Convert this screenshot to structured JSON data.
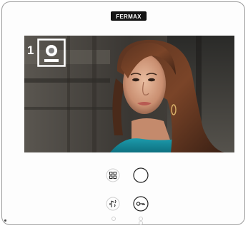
{
  "brand": {
    "logo_text": "FERMAX"
  },
  "screen": {
    "camera_number": "1",
    "camera_icon": "door-panel-icon"
  },
  "controls": {
    "menu_icon": "grid-icon",
    "power_icon": "round-button-icon",
    "talk_icon": "talk-icon",
    "door_icon": "key-icon"
  },
  "colors": {
    "device_border": "#9a9a9a",
    "screen_bg": "#3b3834",
    "teal_top": "#1fa3b4"
  }
}
